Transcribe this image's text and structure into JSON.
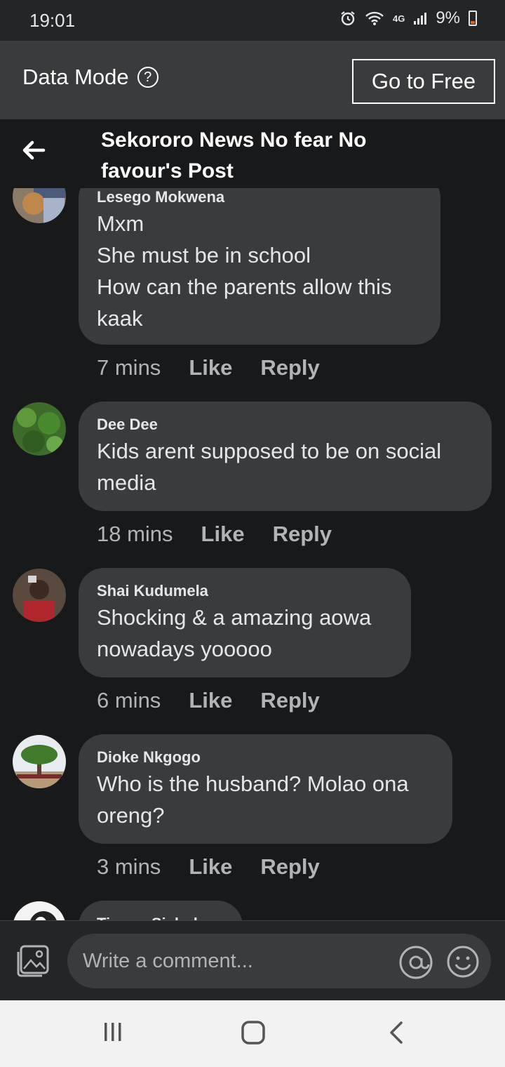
{
  "status": {
    "time": "19:01",
    "network": "4G",
    "battery": "9%"
  },
  "data_bar": {
    "label": "Data Mode",
    "help": "?",
    "button": "Go to Free"
  },
  "header": {
    "title": "Sekororo News No fear No favour's Post"
  },
  "comments": [
    {
      "author": "Lesego Mokwena",
      "lines": [
        "Mxm",
        "She must be in school",
        "How can the parents allow this",
        "kaak"
      ],
      "time": "7 mins",
      "like": "Like",
      "reply": "Reply"
    },
    {
      "author": "Dee Dee",
      "lines": [
        "Kids arent supposed to be on social",
        "media"
      ],
      "time": "18 mins",
      "like": "Like",
      "reply": "Reply"
    },
    {
      "author": "Shai Kudumela",
      "lines": [
        "Shocking & a amazing aowa",
        "nowadays yooooo"
      ],
      "time": "6 mins",
      "like": "Like",
      "reply": "Reply"
    },
    {
      "author": "Dioke Nkgogo",
      "lines": [
        "Who is the husband? Molao ona",
        "oreng?"
      ],
      "time": "3 mins",
      "like": "Like",
      "reply": "Reply"
    },
    {
      "author": "Tiamar Sichube"
    }
  ],
  "composer": {
    "placeholder": "Write a comment..."
  },
  "icons": {
    "back": "back-arrow-icon",
    "photo": "photo-icon",
    "mention": "at-icon",
    "emoji": "smile-icon"
  },
  "colors": {
    "background": "#18191a",
    "bubble": "#3a3b3c",
    "bar": "#3a3b3c",
    "muted_text": "#b0b3b8"
  }
}
